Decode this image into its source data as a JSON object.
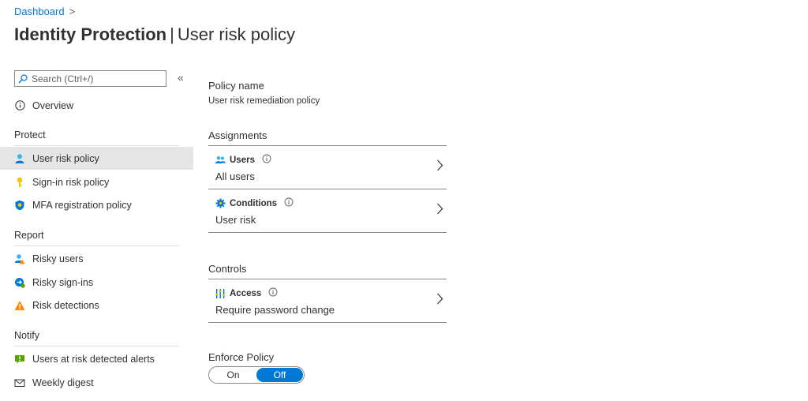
{
  "breadcrumb": {
    "link": "Dashboard",
    "separator": ">"
  },
  "title": {
    "main": "Identity Protection",
    "separator": "|",
    "sub": "User risk policy"
  },
  "sidebar": {
    "search_placeholder": "Search (Ctrl+/)",
    "collapse_glyph": "«",
    "overview": "Overview",
    "sections": {
      "protect": "Protect",
      "report": "Report",
      "notify": "Notify"
    },
    "items": {
      "user_risk_policy": "User risk policy",
      "sign_in_risk_policy": "Sign-in risk policy",
      "mfa_registration_policy": "MFA registration policy",
      "risky_users": "Risky users",
      "risky_sign_ins": "Risky sign-ins",
      "risk_detections": "Risk detections",
      "users_at_risk_alerts": "Users at risk detected alerts",
      "weekly_digest": "Weekly digest"
    },
    "active_item": "user_risk_policy"
  },
  "main": {
    "policy_name_label": "Policy name",
    "policy_name_value": "User risk remediation policy",
    "assignments_heading": "Assignments",
    "users": {
      "title": "Users",
      "value": "All users"
    },
    "conditions": {
      "title": "Conditions",
      "value": "User risk"
    },
    "controls_heading": "Controls",
    "access": {
      "title": "Access",
      "value": "Require password change"
    },
    "enforce_label": "Enforce Policy",
    "toggle": {
      "on": "On",
      "off": "Off",
      "selected": "Off"
    }
  },
  "colors": {
    "accent": "#0078d4",
    "active_bg": "#e5e5e5",
    "warning": "#ff8c00",
    "alert_green": "#57a300"
  }
}
